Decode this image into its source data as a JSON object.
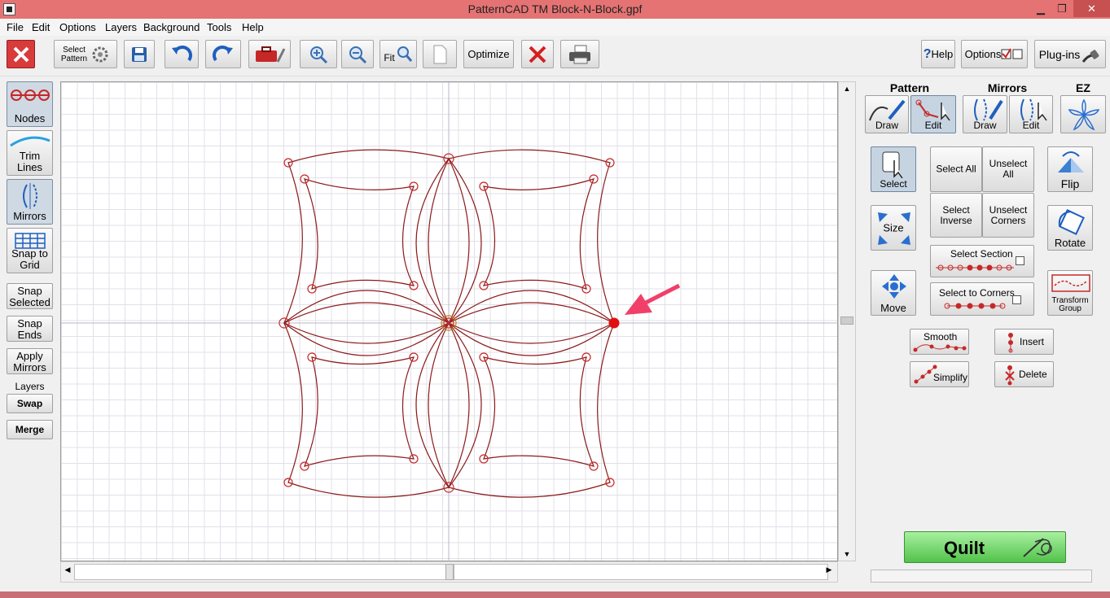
{
  "window": {
    "title": "PatternCAD TM     Block-N-Block.gpf",
    "min_icon": "minimize-icon",
    "max_icon": "maximize-icon",
    "close_icon": "close-icon",
    "min_glyph": "▁",
    "max_glyph": "❐",
    "close_glyph": "✕"
  },
  "menu": [
    "File",
    "Edit",
    "Options",
    "Layers",
    "Background",
    "Tools",
    "Help"
  ],
  "toolbar": {
    "select_pattern": [
      "Select",
      "Pattern"
    ],
    "fit": "Fit",
    "optimize": "Optimize",
    "help": "Help",
    "options": "Options",
    "plugins": "Plug-ins"
  },
  "left_panel": {
    "nodes": "Nodes",
    "trim_lines": [
      "Trim",
      "Lines"
    ],
    "mirrors": "Mirrors",
    "snap_to_grid": [
      "Snap to",
      "Grid"
    ],
    "snap_selected": [
      "Snap",
      "Selected"
    ],
    "snap_ends": [
      "Snap",
      "Ends"
    ],
    "apply_mirrors": [
      "Apply",
      "Mirrors"
    ],
    "layers_label": "Layers",
    "swap": "Swap",
    "merge": "Merge"
  },
  "right_panel": {
    "headers": {
      "pattern": "Pattern",
      "mirrors": "Mirrors",
      "ez": "EZ"
    },
    "pattern_draw": "Draw",
    "pattern_edit": "Edit",
    "mirrors_draw": "Draw",
    "mirrors_edit": "Edit",
    "select": "Select",
    "select_all": "Select All",
    "unselect_all": [
      "Unselect",
      "All"
    ],
    "select_inverse": [
      "Select",
      "Inverse"
    ],
    "unselect_corners": [
      "Unselect",
      "Corners"
    ],
    "select_section": "Select Section",
    "select_to_corners": "Select to Corners",
    "flip": "Flip",
    "size": "Size",
    "rotate": "Rotate",
    "move": "Move",
    "transform_group": [
      "Transform",
      "Group"
    ],
    "smooth": "Smooth",
    "insert": "Insert",
    "simplify": "Simplify",
    "delete": "Delete",
    "quilt": "Quilt"
  },
  "colors": {
    "titlebar": "#e57373",
    "pattern_line": "#8b1a1a",
    "node": "#c62828",
    "arrow": "#f0406a",
    "quilt_green": "#52c24a"
  }
}
